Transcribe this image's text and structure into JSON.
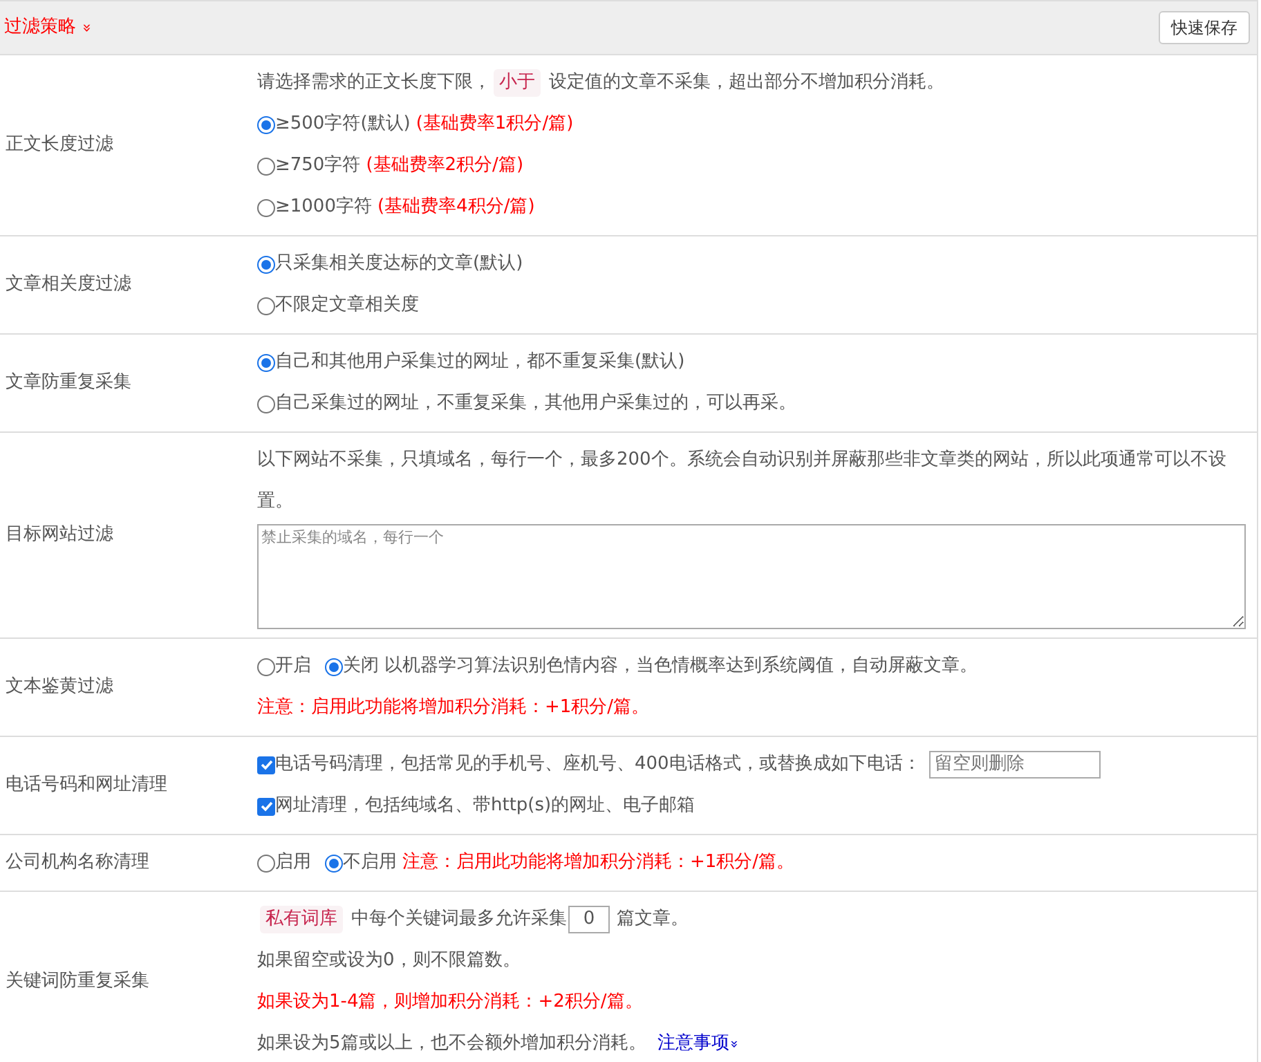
{
  "header": {
    "title": "过滤策略",
    "toggle": "»",
    "save_button": "快速保存"
  },
  "rows": [
    {
      "label": "正文长度过滤",
      "lines": [
        [
          {
            "kind": "text",
            "text": "请选择需求的正文长度下限，"
          },
          {
            "kind": "tag",
            "text": "小于"
          },
          {
            "kind": "text",
            "text": "设定值的文章不采集，超出部分不增加积分消耗。"
          }
        ],
        [
          {
            "kind": "radio",
            "label": "≥500字符(默认)",
            "selected": true
          },
          {
            "kind": "notice",
            "text": "(基础费率1积分/篇)"
          }
        ],
        [
          {
            "kind": "radio",
            "label": "≥750字符",
            "selected": false
          },
          {
            "kind": "notice",
            "text": "(基础费率2积分/篇)"
          }
        ],
        [
          {
            "kind": "radio",
            "label": "≥1000字符",
            "selected": false
          },
          {
            "kind": "notice",
            "text": "(基础费率4积分/篇)"
          }
        ]
      ]
    },
    {
      "label": "文章相关度过滤",
      "lines": [
        [
          {
            "kind": "radio",
            "label": "只采集相关度达标的文章(默认)",
            "selected": true
          }
        ],
        [
          {
            "kind": "radio",
            "label": "不限定文章相关度",
            "selected": false
          }
        ]
      ]
    },
    {
      "label": "文章防重复采集",
      "lines": [
        [
          {
            "kind": "radio",
            "label": "自己和其他用户采集过的网址，都不重复采集(默认)",
            "selected": true
          }
        ],
        [
          {
            "kind": "radio",
            "label": "自己采集过的网址，不重复采集，其他用户采集过的，可以再采。",
            "selected": false
          }
        ]
      ]
    },
    {
      "label": "目标网站过滤",
      "lines": [
        [
          {
            "kind": "text",
            "text": "以下网站不采集，只填域名，每行一个，最多200个。系统会自动识别并屏蔽那些非文章类的网站，所以此项通常可以不设置。"
          }
        ],
        [
          {
            "kind": "textarea",
            "placeholder": "禁止采集的域名，每行一个"
          }
        ]
      ]
    },
    {
      "label": "文本鉴黄过滤",
      "lines": [
        [
          {
            "kind": "radio",
            "label": "开启",
            "selected": false
          },
          {
            "kind": "radio",
            "label": "关闭",
            "selected": true
          },
          {
            "kind": "text",
            "text": "以机器学习算法识别色情内容，当色情概率达到系统阈值，自动屏蔽文章。"
          }
        ],
        [
          {
            "kind": "notice",
            "text": "注意：启用此功能将增加积分消耗：+1积分/篇。"
          }
        ]
      ]
    },
    {
      "label": "电话号码和网址清理",
      "lines": [
        [
          {
            "kind": "checkbox",
            "label": "电话号码清理，包括常见的手机号、座机号、400电话格式，或替换成如下电话：",
            "checked": true
          },
          {
            "kind": "input",
            "placeholder": "留空则删除"
          }
        ],
        [
          {
            "kind": "checkbox",
            "label": "网址清理，包括纯域名、带http(s)的网址、电子邮箱",
            "checked": true
          }
        ]
      ]
    },
    {
      "label": "公司机构名称清理",
      "lines": [
        [
          {
            "kind": "radio",
            "label": "启用",
            "selected": false
          },
          {
            "kind": "radio",
            "label": "不启用",
            "selected": true
          },
          {
            "kind": "notice",
            "text": "注意：启用此功能将增加积分消耗：+1积分/篇。"
          }
        ]
      ]
    },
    {
      "label": "关键词防重复采集",
      "lines": [
        [
          {
            "kind": "tag",
            "text": "私有词库"
          },
          {
            "kind": "text",
            "text": "中每个关键词最多允许采集"
          },
          {
            "kind": "number",
            "value": "0"
          },
          {
            "kind": "text",
            "text": "篇文章。"
          }
        ],
        [
          {
            "kind": "text",
            "text": "如果留空或设为0，则不限篇数。"
          }
        ],
        [
          {
            "kind": "notice",
            "text": "如果设为1-4篇，则增加积分消耗：+2积分/篇。"
          }
        ],
        [
          {
            "kind": "text",
            "text": "如果设为5篇或以上，也不会额外增加积分消耗。"
          },
          {
            "kind": "link",
            "text": "注意事项",
            "toggle": "»"
          }
        ]
      ]
    }
  ]
}
